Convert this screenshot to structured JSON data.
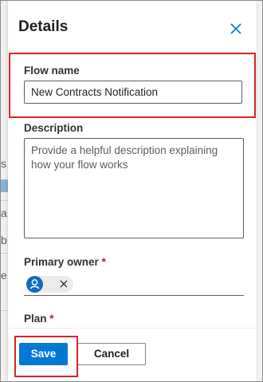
{
  "panel": {
    "title": "Details",
    "close_icon": "close-icon"
  },
  "fields": {
    "flow_name": {
      "label": "Flow name",
      "value": "New Contracts Notification"
    },
    "description": {
      "label": "Description",
      "placeholder": "Provide a helpful description explaining how your flow works"
    },
    "primary_owner": {
      "label": "Primary owner",
      "required_mark": "*",
      "avatar_icon": "person-icon",
      "remove_icon": "close-icon"
    },
    "plan": {
      "label": "Plan",
      "required_mark": "*"
    }
  },
  "footer": {
    "save_label": "Save",
    "cancel_label": "Cancel"
  },
  "background": {
    "fragment_1": "s",
    "fragment_2": "a",
    "fragment_3": "b",
    "fragment_4": "e"
  },
  "colors": {
    "accent": "#0078d4",
    "highlight": "#d9232a",
    "required": "#a4262c"
  }
}
